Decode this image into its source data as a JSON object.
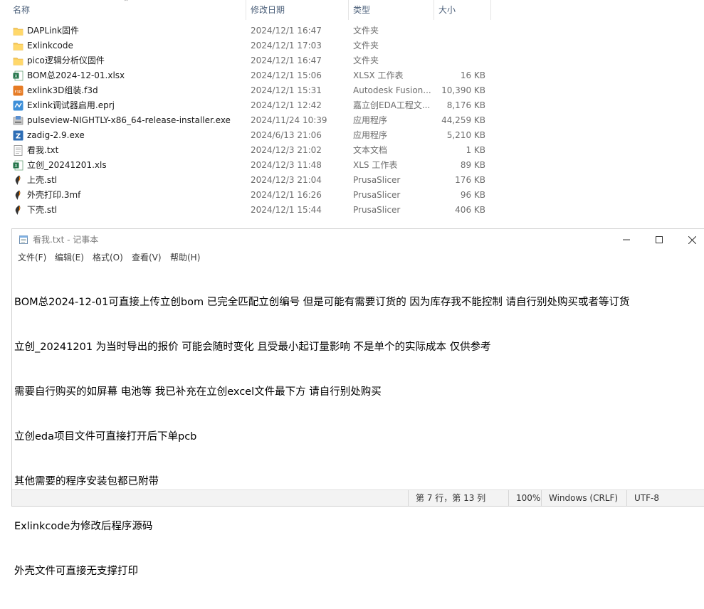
{
  "explorer": {
    "columns": {
      "name": "名称",
      "modified": "修改日期",
      "type": "类型",
      "size": "大小"
    },
    "files": [
      {
        "name": "DAPLink固件",
        "modified": "2024/12/1 16:47",
        "type": "文件夹",
        "size": "",
        "icon": "folder-icon"
      },
      {
        "name": "Exlinkcode",
        "modified": "2024/12/1 17:03",
        "type": "文件夹",
        "size": "",
        "icon": "folder-icon"
      },
      {
        "name": "pico逻辑分析仪固件",
        "modified": "2024/12/1 16:47",
        "type": "文件夹",
        "size": "",
        "icon": "folder-icon"
      },
      {
        "name": "BOM总2024-12-01.xlsx",
        "modified": "2024/12/1 15:06",
        "type": "XLSX 工作表",
        "size": "16 KB",
        "icon": "excel-icon"
      },
      {
        "name": "exlink3D组装.f3d",
        "modified": "2024/12/1 15:31",
        "type": "Autodesk Fusion...",
        "size": "10,390 KB",
        "icon": "f3d-icon"
      },
      {
        "name": "Exlink调试器启用.eprj",
        "modified": "2024/12/1 12:42",
        "type": "嘉立创EDA工程文...",
        "size": "8,176 KB",
        "icon": "eda-icon"
      },
      {
        "name": "pulseview-NIGHTLY-x86_64-release-installer.exe",
        "modified": "2024/11/24 10:39",
        "type": "应用程序",
        "size": "44,259 KB",
        "icon": "installer-icon"
      },
      {
        "name": "zadig-2.9.exe",
        "modified": "2024/6/13 21:06",
        "type": "应用程序",
        "size": "5,210 KB",
        "icon": "zadig-icon"
      },
      {
        "name": "看我.txt",
        "modified": "2024/12/3 21:02",
        "type": "文本文档",
        "size": "1 KB",
        "icon": "text-file-icon"
      },
      {
        "name": "立创_20241201.xls",
        "modified": "2024/12/3 11:48",
        "type": "XLS 工作表",
        "size": "89 KB",
        "icon": "excel-icon"
      },
      {
        "name": "上壳.stl",
        "modified": "2024/12/3 21:04",
        "type": "PrusaSlicer",
        "size": "176 KB",
        "icon": "prusaslicer-icon"
      },
      {
        "name": "外壳打印.3mf",
        "modified": "2024/12/1 16:26",
        "type": "PrusaSlicer",
        "size": "96 KB",
        "icon": "prusaslicer-icon"
      },
      {
        "name": "下壳.stl",
        "modified": "2024/12/1 15:44",
        "type": "PrusaSlicer",
        "size": "406 KB",
        "icon": "prusaslicer-icon"
      }
    ]
  },
  "notepad": {
    "title": "看我.txt - 记事本",
    "menu": [
      "文件(F)",
      "编辑(E)",
      "格式(O)",
      "查看(V)",
      "帮助(H)"
    ],
    "lines": [
      "BOM总2024-12-01可直接上传立创bom 已完全匹配立创编号 但是可能有需要订货的 因为库存我不能控制 请自行别处购买或者等订货",
      "立创_20241201 为当时导出的报价 可能会随时变化 且受最小起订量影响 不是单个的实际成本 仅供参考",
      "需要自行购买的如屏幕 电池等 我已补充在立创excel文件最下方 请自行别处购买",
      "立创eda项目文件可直接打开后下单pcb",
      "其他需要的程序安装包都已附带",
      "Exlinkcode为修改后程序源码",
      "外壳文件可直接无支撑打印"
    ],
    "status": {
      "position": "第 7 行，第 13 列",
      "zoom": "100%",
      "line_ending": "Windows (CRLF)",
      "encoding": "UTF-8"
    }
  }
}
